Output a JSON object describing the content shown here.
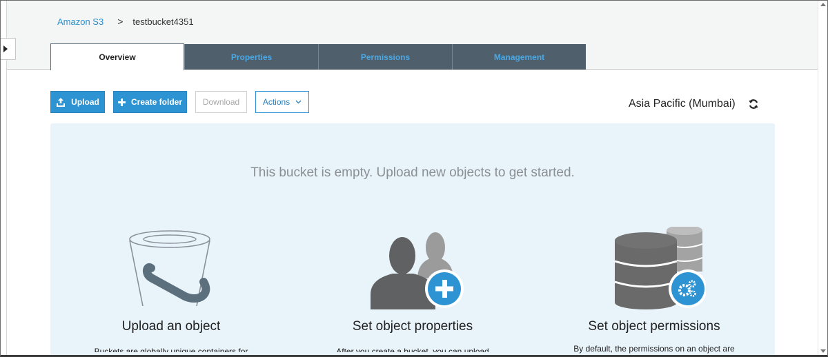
{
  "breadcrumb": {
    "root": "Amazon S3",
    "separator": ">",
    "current": "testbucket4351"
  },
  "tabs": [
    {
      "label": "Overview",
      "active": true
    },
    {
      "label": "Properties",
      "active": false
    },
    {
      "label": "Permissions",
      "active": false
    },
    {
      "label": "Management",
      "active": false
    }
  ],
  "toolbar": {
    "upload_label": "Upload",
    "create_folder_label": "Create folder",
    "download_label": "Download",
    "actions_label": "Actions"
  },
  "region": {
    "label": "Asia Pacific (Mumbai)"
  },
  "empty_state": {
    "message": "This bucket is empty. Upload new objects to get started.",
    "features": [
      {
        "title": "Upload an object",
        "description": "Buckets are globally unique containers for",
        "icon": "bucket-icon"
      },
      {
        "title": "Set object properties",
        "description": "After you create a bucket, you can upload",
        "icon": "users-add-icon"
      },
      {
        "title": "Set object permissions",
        "description": "By default, the permissions on an object are",
        "icon": "database-gear-icon"
      }
    ]
  },
  "colors": {
    "accent": "#2e93d2",
    "tab_inactive_bg": "#4f5f6c",
    "tab_inactive_text": "#4aa8e4",
    "panel_bg": "#e8f3fa"
  }
}
